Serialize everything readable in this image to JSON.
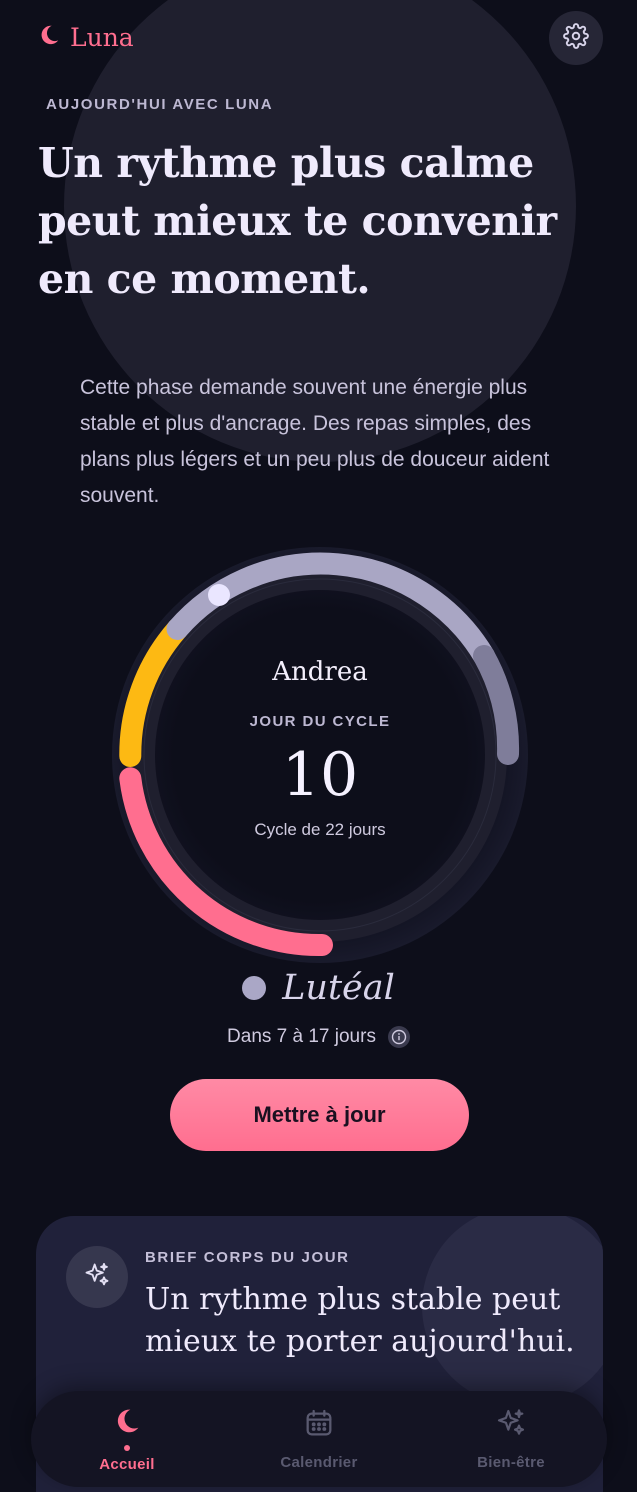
{
  "header": {
    "brand": "Luna",
    "settings_icon": "gear-icon"
  },
  "hero": {
    "eyebrow": "AUJOURD'HUI AVEC LUNA",
    "headline": "Un rythme plus calme peut mieux te convenir en ce moment.",
    "body": "Cette phase demande souvent une énergie plus stable et plus d'ancrage. Des repas simples, des plans plus légers et un peu plus de douceur aident souvent."
  },
  "cycle": {
    "user_name": "Andrea",
    "label": "JOUR DU CYCLE",
    "day": "10",
    "length_text": "Cycle de 22 jours",
    "phase_name": "Lutéal",
    "phase_window": "Dans 7 à 17 jours",
    "colors": {
      "menstrual": "#ff6e8f",
      "follicular": "#fdb913",
      "ovulation": "#a9a6c4",
      "luteal": "#7f7d9a",
      "track": "#1f1f2e"
    }
  },
  "actions": {
    "update_label": "Mettre à jour"
  },
  "brief": {
    "eyebrow": "BRIEF CORPS DU JOUR",
    "title": "Un rythme plus stable peut mieux te porter aujourd'hui.",
    "icon": "sparkles-icon"
  },
  "nav": {
    "items": [
      {
        "label": "Accueil",
        "icon": "moon-icon",
        "active": true
      },
      {
        "label": "Calendrier",
        "icon": "calendar-icon",
        "active": false
      },
      {
        "label": "Bien-être",
        "icon": "sparkles-icon",
        "active": false
      }
    ]
  }
}
